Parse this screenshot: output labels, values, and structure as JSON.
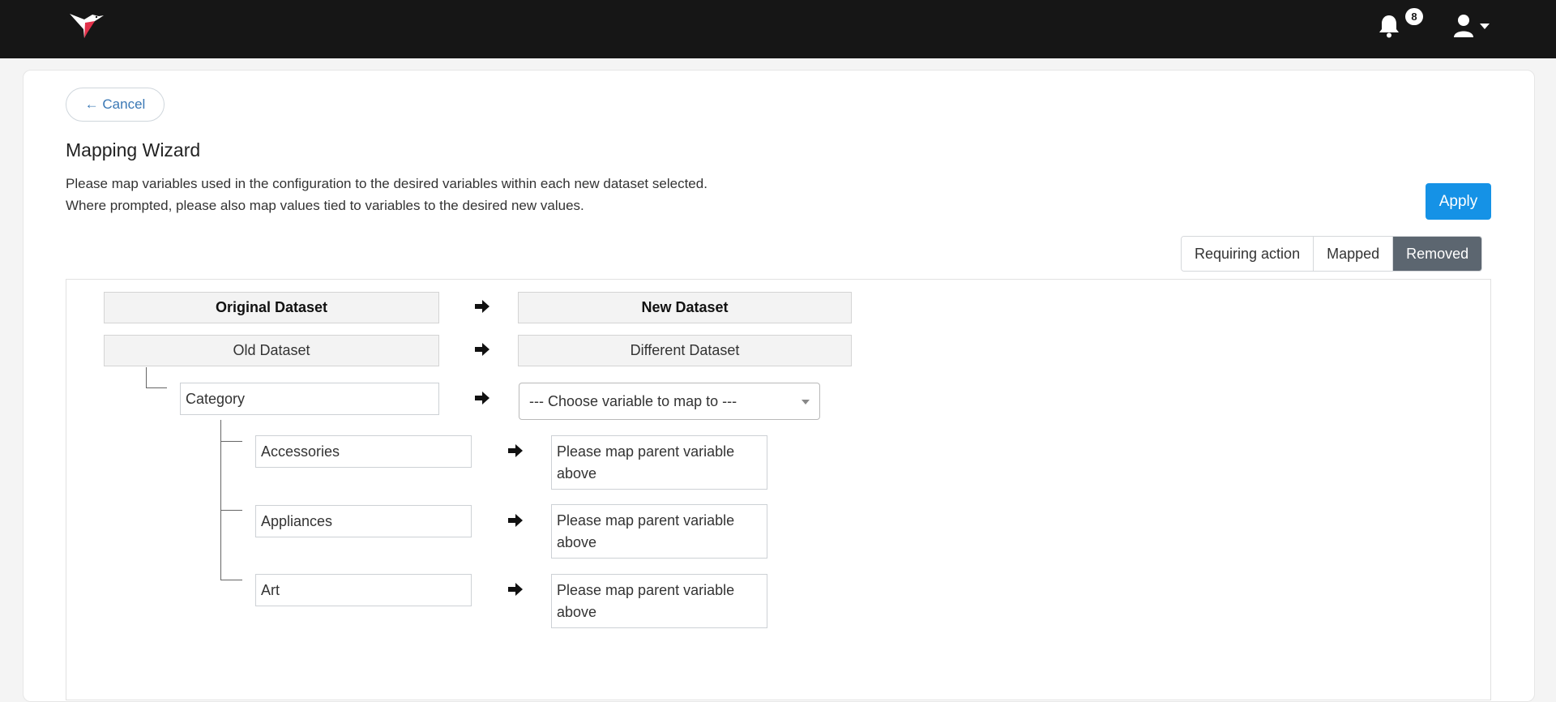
{
  "header": {
    "logo_icon": "hummingbird-logo",
    "notification_count": "8",
    "bell_icon": "bell-icon",
    "user_icon": "user-icon"
  },
  "cancel_label": "← Cancel",
  "title": "Mapping Wizard",
  "description": {
    "line1": "Please map variables used in the configuration to the desired variables within each new dataset selected.",
    "line2": "Where prompted, please also map values tied to variables to the desired new values."
  },
  "apply_label": "Apply",
  "filters": [
    {
      "label": "Requiring action",
      "active": false
    },
    {
      "label": "Mapped",
      "active": false
    },
    {
      "label": "Removed",
      "active": true
    }
  ],
  "mapping": {
    "header_original": "Original Dataset",
    "header_new": "New Dataset",
    "original_dataset": "Old Dataset",
    "new_dataset": "Different Dataset",
    "variable": "Category",
    "variable_select_placeholder": "--- Choose variable to map to ---",
    "values": [
      {
        "original": "Accessories",
        "target": "Please map parent variable above"
      },
      {
        "original": "Appliances",
        "target": "Please map parent variable above"
      },
      {
        "original": "Art",
        "target": "Please map parent variable above"
      }
    ]
  },
  "colors": {
    "topbar": "#161616",
    "accent": "#1592e6",
    "active_filter": "#5c6670",
    "logo_red": "#e2314a"
  }
}
